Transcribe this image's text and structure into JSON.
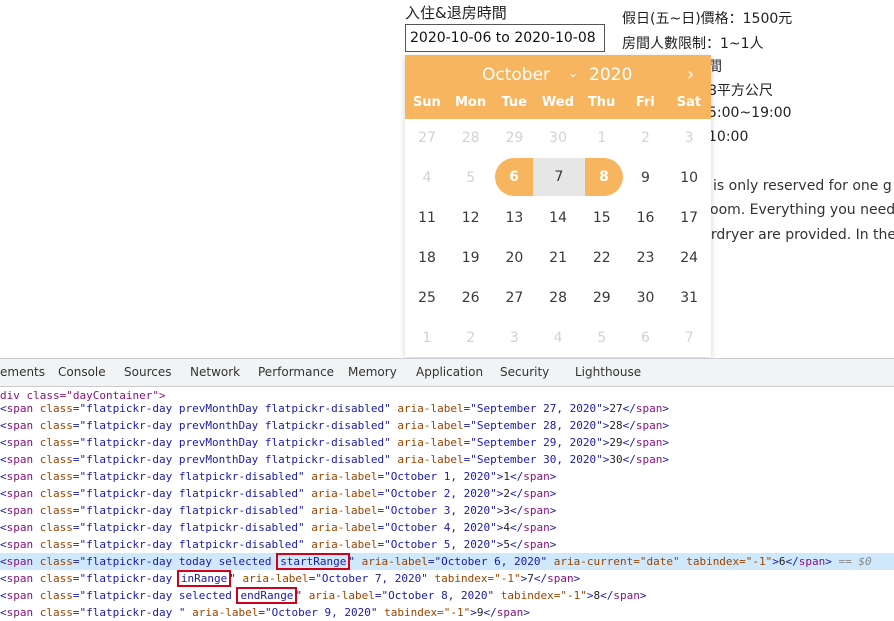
{
  "page": {
    "checkin_label": "入住&退房時間",
    "date_value": "2020-10-06 to 2020-10-08",
    "room_info": [
      "假日(五~日)價格：1500元",
      "房間人數限制：1~1人",
      "間",
      "8平方公尺",
      "5:00~19:00",
      "10:00"
    ],
    "description": [
      "is only reserved for one g",
      "oom. Everything you need",
      "irdryer are provided. In the"
    ]
  },
  "calendar": {
    "month": "October",
    "year": "2020",
    "next_icon": "chevron-right-icon",
    "weekdays": [
      "Sun",
      "Mon",
      "Tue",
      "Wed",
      "Thu",
      "Fri",
      "Sat"
    ],
    "rows": [
      [
        "27",
        "28",
        "29",
        "30",
        "1",
        "2",
        "3"
      ],
      [
        "4",
        "5",
        "6",
        "7",
        "8",
        "9",
        "10"
      ],
      [
        "11",
        "12",
        "13",
        "14",
        "15",
        "16",
        "17"
      ],
      [
        "18",
        "19",
        "20",
        "21",
        "22",
        "23",
        "24"
      ],
      [
        "25",
        "26",
        "27",
        "28",
        "29",
        "30",
        "31"
      ],
      [
        "1",
        "2",
        "3",
        "4",
        "5",
        "6",
        "7"
      ]
    ],
    "range_start": "6",
    "range_mid": "7",
    "range_end": "8",
    "accent": "#f8b560"
  },
  "devtools": {
    "tabs": [
      "ements",
      "Console",
      "Sources",
      "Network",
      "Performance",
      "Memory",
      "Application",
      "Security",
      "Lighthouse"
    ],
    "lines": [
      {
        "pre": "div class=\"dayContainer\">",
        "kind": "plain"
      },
      {
        "cls": "flatpickr-day prevMonthDay flatpickr-disabled",
        "label": "September 27, 2020",
        "text": "27"
      },
      {
        "cls": "flatpickr-day prevMonthDay flatpickr-disabled",
        "label": "September 28, 2020",
        "text": "28"
      },
      {
        "cls": "flatpickr-day prevMonthDay flatpickr-disabled",
        "label": "September 29, 2020",
        "text": "29"
      },
      {
        "cls": "flatpickr-day prevMonthDay flatpickr-disabled",
        "label": "September 30, 2020",
        "text": "30"
      },
      {
        "cls": "flatpickr-day flatpickr-disabled",
        "label": "October 1, 2020",
        "text": "1"
      },
      {
        "cls": "flatpickr-day flatpickr-disabled",
        "label": "October 2, 2020",
        "text": "2"
      },
      {
        "cls": "flatpickr-day flatpickr-disabled",
        "label": "October 3, 2020",
        "text": "3"
      },
      {
        "cls": "flatpickr-day flatpickr-disabled",
        "label": "October 4, 2020",
        "text": "4"
      },
      {
        "cls": "flatpickr-day flatpickr-disabled",
        "label": "October 5, 2020",
        "text": "5"
      }
    ],
    "line_today": {
      "cls_pre": "flatpickr-day today selected ",
      "cls_box": "startRange",
      "label": "October 6, 2020",
      "extra": " aria-current=\"date\" tabindex=\"-1\"",
      "text": "6",
      "suffix": " == $0"
    },
    "line_inrange": {
      "cls_pre": "flatpickr-day ",
      "cls_box": "inRange",
      "label": "October 7, 2020",
      "extra": " tabindex=\"-1\"",
      "text": "7"
    },
    "line_end": {
      "cls_pre": "flatpickr-day selected ",
      "cls_box": "endRange",
      "label": "October 8, 2020",
      "extra": " tabindex=\"-1\"",
      "text": "8"
    },
    "line_last": {
      "cls": "flatpickr-day ",
      "label": "October 9, 2020",
      "extra": " tabindex=\"-1\"",
      "text": "9"
    }
  }
}
